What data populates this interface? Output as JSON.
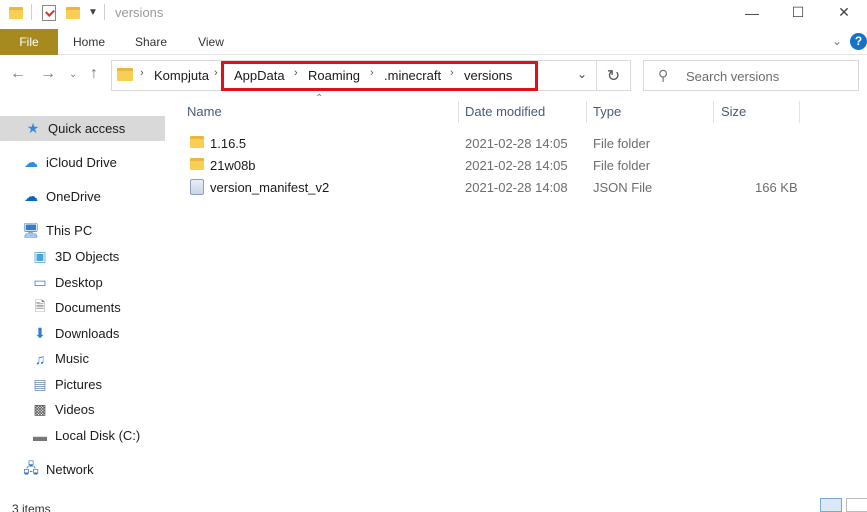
{
  "window": {
    "title": "versions"
  },
  "ribbon": {
    "tabs": [
      "File",
      "Home",
      "Share",
      "View"
    ]
  },
  "address": {
    "crumbs": [
      "Kompjuta",
      "AppData",
      "Roaming",
      ".minecraft",
      "versions"
    ]
  },
  "search": {
    "placeholder": "Search versions"
  },
  "nav": {
    "items": [
      {
        "label": "Quick access"
      },
      {
        "label": "iCloud Drive"
      },
      {
        "label": "OneDrive"
      },
      {
        "label": "This PC"
      },
      {
        "label": "3D Objects"
      },
      {
        "label": "Desktop"
      },
      {
        "label": "Documents"
      },
      {
        "label": "Downloads"
      },
      {
        "label": "Music"
      },
      {
        "label": "Pictures"
      },
      {
        "label": "Videos"
      },
      {
        "label": "Local Disk (C:)"
      },
      {
        "label": "Network"
      }
    ]
  },
  "columns": {
    "name": "Name",
    "date": "Date modified",
    "type": "Type",
    "size": "Size"
  },
  "files": [
    {
      "name": "1.16.5",
      "date": "2021-02-28 14:05",
      "type": "File folder",
      "size": "",
      "icon": "folder-icon"
    },
    {
      "name": "21w08b",
      "date": "2021-02-28 14:05",
      "type": "File folder",
      "size": "",
      "icon": "folder-icon"
    },
    {
      "name": "version_manifest_v2",
      "date": "2021-02-28 14:08",
      "type": "JSON File",
      "size": "166 KB",
      "icon": "json-file-icon"
    }
  ],
  "status": {
    "count": "3 items"
  },
  "colors": {
    "file_tab": "#a78a1f",
    "highlight": "#e0101b",
    "selected_nav": "#d9d9d9"
  }
}
